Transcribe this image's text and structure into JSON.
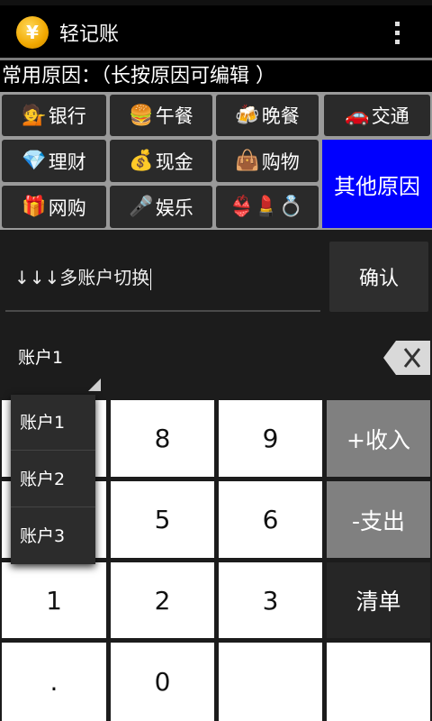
{
  "app": {
    "title": "轻记账",
    "logo_char": "¥",
    "menu_icon": "overflow-menu-icon"
  },
  "reasons": {
    "heading": "常用原因：（长按原因可编辑 ）",
    "items": [
      {
        "label": "银行",
        "icon": "💁"
      },
      {
        "label": "午餐",
        "icon": "🍔"
      },
      {
        "label": "晚餐",
        "icon": "🍻"
      },
      {
        "label": "交通",
        "icon": "🚗"
      },
      {
        "label": "理财",
        "icon": "💎"
      },
      {
        "label": "现金",
        "icon": "💰"
      },
      {
        "label": "购物",
        "icon": "👜"
      },
      {
        "label": "网购",
        "icon": "🎁"
      },
      {
        "label": "娱乐",
        "icon": "🎤"
      },
      {
        "label": "",
        "icon": "👙💄💍"
      }
    ],
    "other_label": "其他原因",
    "other_color": "#0000ff"
  },
  "entry": {
    "switch_text": "↓↓↓多账户切换",
    "confirm_label": "确认",
    "account_selected": "账户1",
    "backspace_icon": "backspace-icon",
    "account_options": [
      "账户1",
      "账户2",
      "账户3"
    ]
  },
  "keypad": {
    "keys": [
      "8",
      "9",
      "5",
      "6",
      "1",
      "2",
      "3",
      ".",
      "0"
    ],
    "income_label": "+收入",
    "expense_label": "-支出",
    "list_label": "清单"
  }
}
